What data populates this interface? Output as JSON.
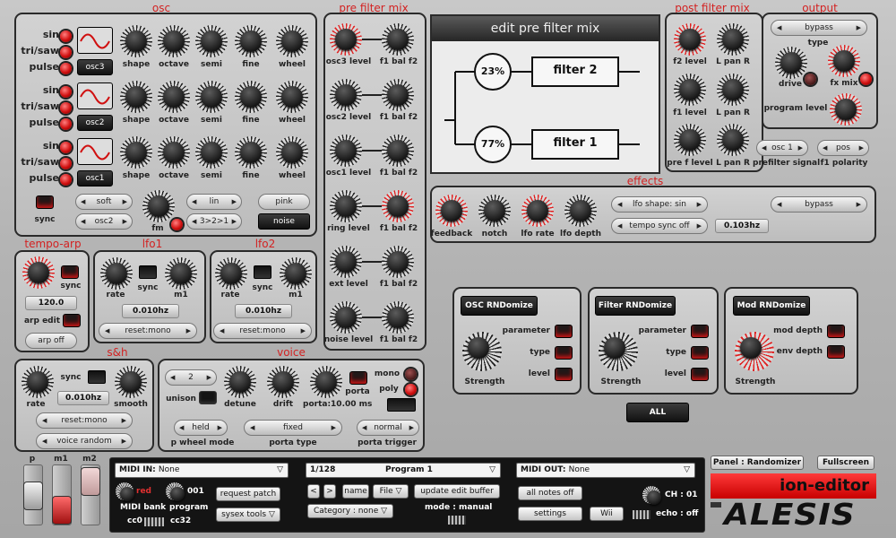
{
  "osc": {
    "title": "osc",
    "wave_labels": [
      "sin",
      "tri/saw",
      "pulse"
    ],
    "rows": [
      {
        "name": "osc3"
      },
      {
        "name": "osc2"
      },
      {
        "name": "osc1"
      }
    ],
    "knob_labels": [
      "shape",
      "octave",
      "semi",
      "fine",
      "wheel"
    ],
    "sync_label": "sync",
    "soft": "soft",
    "osc2_select": "osc2",
    "fm_label": "fm",
    "lin": "lin",
    "route": "3>2>1",
    "pink": "pink",
    "noise": "noise"
  },
  "pre_filter_mix": {
    "title": "pre filter mix",
    "rows": [
      "osc3 level",
      "osc2 level",
      "osc1 level",
      "ring level",
      "ext level",
      "noise level"
    ],
    "bal_label": "f1 bal f2"
  },
  "edit_panel": {
    "title": "edit pre filter mix",
    "top_pct": "23%",
    "bottom_pct": "77%",
    "top_filter": "filter 2",
    "bottom_filter": "filter 1"
  },
  "post_filter_mix": {
    "title": "post filter mix",
    "labels": [
      "f2 level",
      "L pan R",
      "f1 level",
      "L pan R",
      "pre f level",
      "L pan R"
    ],
    "osc_select": "osc 1",
    "prefilter_signal": "prefilter signal",
    "pos": "pos",
    "f1_polarity": "f1 polarity"
  },
  "output": {
    "title": "output",
    "type_value": "bypass",
    "type_label": "type",
    "drive": "drive",
    "fx_mix": "fx mix",
    "program_level": "program level"
  },
  "effects": {
    "title": "effects",
    "knobs": [
      "feedback",
      "notch",
      "lfo rate",
      "lfo depth"
    ],
    "lfo_shape": "lfo shape: sin",
    "tempo_sync": "tempo sync off",
    "rate_value": "0.103hz",
    "type": "bypass"
  },
  "tempo_arp": {
    "title": "tempo-arp",
    "sync": "sync",
    "bpm": "120.0",
    "arp_edit": "arp edit",
    "arp_off": "arp off"
  },
  "lfo1": {
    "title": "lfo1",
    "rate": "rate",
    "sync": "sync",
    "m1": "m1",
    "value": "0.010hz",
    "reset": "reset:mono"
  },
  "lfo2": {
    "title": "lfo2",
    "rate": "rate",
    "sync": "sync",
    "m1": "m1",
    "value": "0.010hz",
    "reset": "reset:mono"
  },
  "sh": {
    "title": "s&h",
    "sync": "sync",
    "value": "0.010hz",
    "rate": "rate",
    "smooth": "smooth",
    "reset": "reset:mono",
    "voice_random": "voice random"
  },
  "voice": {
    "title": "voice",
    "unison_value": "2",
    "unison": "unison",
    "detune": "detune",
    "drift": "drift",
    "porta": "porta:10.00 ms",
    "porta_btn": "porta",
    "mono": "mono",
    "poly": "poly",
    "held": "held",
    "fixed": "fixed",
    "normal": "normal",
    "p_wheel_mode": "p wheel mode",
    "porta_type": "porta type",
    "porta_trigger": "porta trigger"
  },
  "randomize": [
    {
      "title": "OSC RNDomize",
      "params": [
        "parameter",
        "type",
        "level"
      ],
      "strength": "Strength"
    },
    {
      "title": "Filter RNDomize",
      "params": [
        "parameter",
        "type",
        "level"
      ],
      "strength": "Strength"
    },
    {
      "title": "Mod RNDomize",
      "params": [
        "mod depth",
        "env depth"
      ],
      "strength": "Strength"
    }
  ],
  "all_button": "ALL",
  "sliders": [
    "p",
    "m1",
    "m2"
  ],
  "midi_in": {
    "label": "MIDI IN:",
    "value": "None",
    "bank_color": "red",
    "program_num": "001",
    "midi_bank": "MIDI bank",
    "program": "program",
    "cc0": "cc0",
    "cc32": "cc32",
    "request_patch": "request patch",
    "sysex_tools": "sysex tools"
  },
  "program_bar": {
    "counter": "1/128",
    "name": "Program 1",
    "prev": "<",
    "next": ">",
    "name_btn": "name",
    "file_btn": "File",
    "update_btn": "update edit buffer",
    "category": "Category : none",
    "mode": "mode : manual"
  },
  "midi_out": {
    "label": "MIDI OUT:",
    "value": "None",
    "all_notes_off": "all notes off",
    "ch": "CH : 01",
    "settings": "settings",
    "wii": "Wii",
    "echo": "echo : off"
  },
  "brand": {
    "panel": "Panel :  Randomizer",
    "fullscreen": "Fullscreen",
    "editor": "ion-editor",
    "alesis": "ALESIS"
  }
}
